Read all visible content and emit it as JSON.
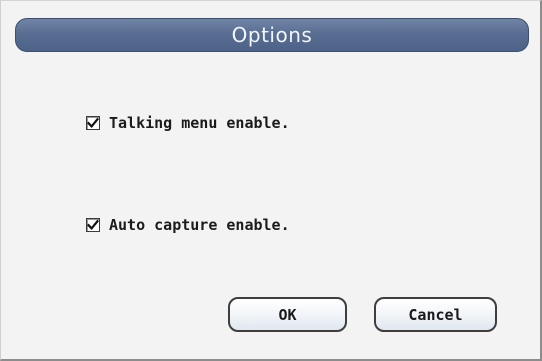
{
  "dialog": {
    "title": "Options",
    "options": [
      {
        "label": "Talking menu enable.",
        "checked": true
      },
      {
        "label": "Auto capture enable.",
        "checked": true
      }
    ],
    "buttons": {
      "ok_label": "OK",
      "cancel_label": "Cancel"
    }
  },
  "colors": {
    "title_bar": "#596e92",
    "title_text": "#f2f5fa",
    "dialog_background": "#f3f3f3",
    "button_border": "#3e3e3e"
  },
  "icons": {
    "checkbox_mark": "checkmark-icon"
  }
}
